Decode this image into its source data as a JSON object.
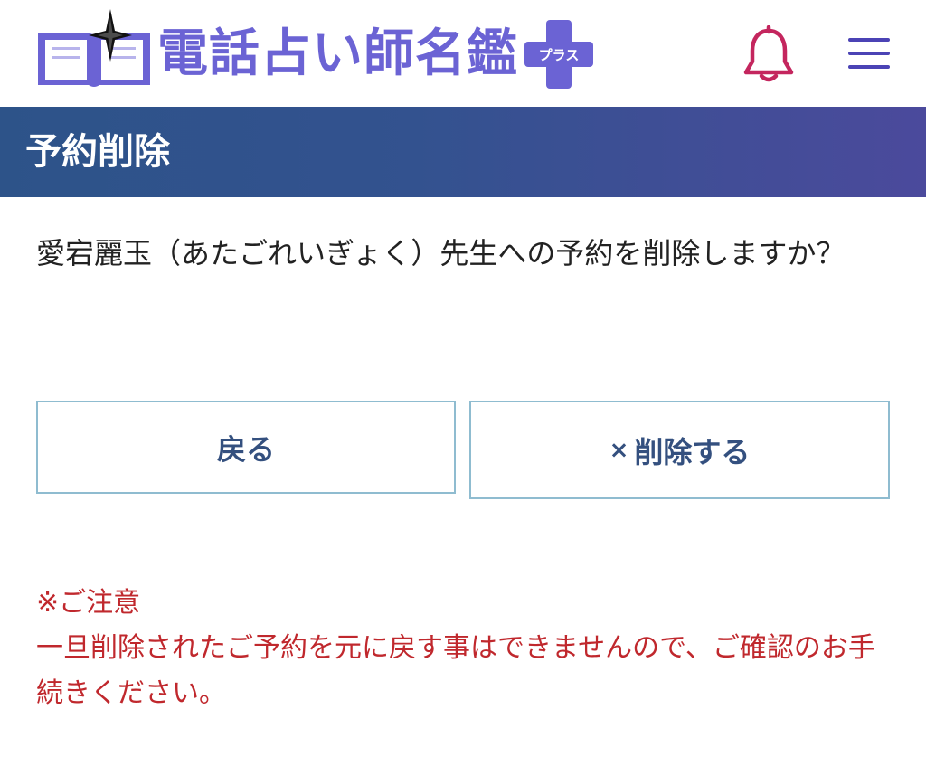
{
  "header": {
    "logo_text": "電話占い師名鑑",
    "logo_plus_label": "プラス",
    "icons": {
      "logo": "open-book-star-icon",
      "bell": "bell-icon",
      "menu": "hamburger-menu-icon"
    },
    "colors": {
      "logo": "#6b63d4",
      "bell": "#c4265e",
      "menu": "#4b43b5"
    }
  },
  "titlebar": {
    "title": "予約削除"
  },
  "main": {
    "message": "愛宕麗玉（あたごれいぎょく）先生への予約を削除しますか？",
    "back_label": "戻る",
    "delete_icon": "×",
    "delete_label": "削除する"
  },
  "notice": {
    "heading": "※ご注意",
    "body": "一旦削除されたご予約を元に戻す事はできませんので、ご確認のお手続きください。"
  },
  "colors": {
    "titlebar_start": "#2d5389",
    "titlebar_end": "#4b4a9c",
    "button_border": "#8fbcd0",
    "button_text": "#34507f",
    "notice_text": "#c0282d"
  }
}
